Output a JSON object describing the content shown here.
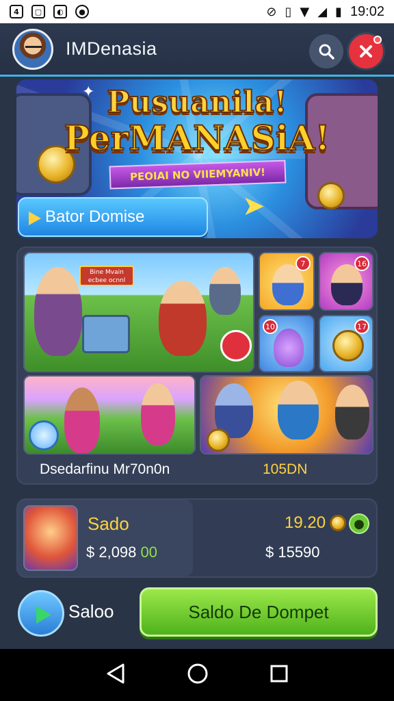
{
  "status_bar": {
    "time": "19:02",
    "left_icons": [
      "notification-icon-a",
      "notification-icon-b",
      "notification-icon-c",
      "notification-icon-d"
    ],
    "right_icons": [
      "mute-icon",
      "vibrate-icon",
      "wifi-icon",
      "signal-icon",
      "battery-icon"
    ]
  },
  "header": {
    "title": "IMDenasia",
    "search_icon": "search-icon",
    "close_icon": "close-icon"
  },
  "banner": {
    "title_line1": "Pusuanila!",
    "title_line2": "PerMANASiA!",
    "ribbon_text": "PEOIAI NO VIIEMYANIV!",
    "button_label": "Bator Domise"
  },
  "games": {
    "sign_text": "Bine Mvain ecbee ocnnl",
    "badges": [
      "7",
      "16",
      "10",
      "17"
    ],
    "label_left": "Dsedarfinu Mr70n0n",
    "label_right": "105DN"
  },
  "saldo": {
    "label": "Sado",
    "amount_prefix": "$ 2,098",
    "amount_suffix": "00",
    "right_top_value": "19.20",
    "right_amount": "$ 15590"
  },
  "actions": {
    "secondary_label": "Saloo",
    "wallet_button_label": "Saldo De Dompet"
  },
  "colors": {
    "background": "#2a3447",
    "accent_yellow": "#ffd23f",
    "accent_green": "#6cc836",
    "accent_blue": "#1f86e3",
    "accent_red": "#e6323e"
  }
}
